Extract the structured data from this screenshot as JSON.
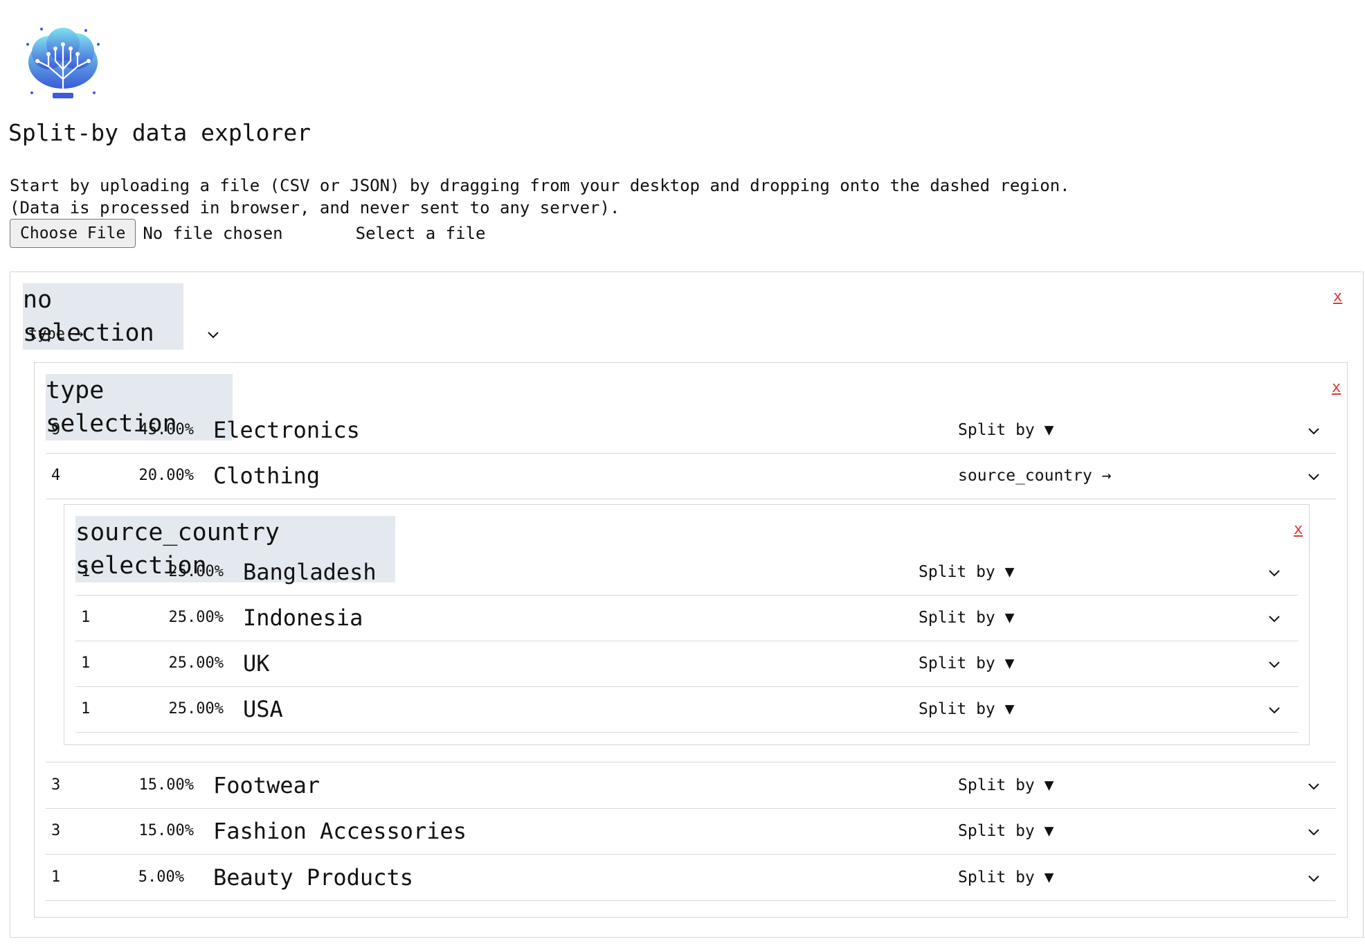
{
  "app": {
    "title": "Split-by data explorer",
    "intro_line1": "Start by uploading a file (CSV or JSON) by dragging from your desktop and dropping onto the dashed region.",
    "intro_line2": "(Data is processed in browser, and never sent to any server).",
    "choose_file_label": "Choose File",
    "no_file_text": "No file chosen",
    "select_file_text": "Select a file"
  },
  "root_panel": {
    "title": "no selection",
    "close_label": "x",
    "selector_label": "type →"
  },
  "type_panel": {
    "title": "type selection",
    "close_label": "x",
    "rows": [
      {
        "count": "9",
        "pct": "45.00%",
        "label": "Electronics",
        "split": "Split by ▼"
      },
      {
        "count": "4",
        "pct": "20.00%",
        "label": "Clothing",
        "split": "source_country →"
      },
      {
        "count": "3",
        "pct": "15.00%",
        "label": "Footwear",
        "split": "Split by ▼"
      },
      {
        "count": "3",
        "pct": "15.00%",
        "label": "Fashion Accessories",
        "split": "Split by ▼"
      },
      {
        "count": "1",
        "pct": "5.00%",
        "label": "Beauty Products",
        "split": "Split by ▼"
      }
    ]
  },
  "country_panel": {
    "title": "source_country selection",
    "close_label": "x",
    "rows": [
      {
        "count": "1",
        "pct": "25.00%",
        "label": "Bangladesh",
        "split": "Split by ▼"
      },
      {
        "count": "1",
        "pct": "25.00%",
        "label": "Indonesia",
        "split": "Split by ▼"
      },
      {
        "count": "1",
        "pct": "25.00%",
        "label": "UK",
        "split": "Split by ▼"
      },
      {
        "count": "1",
        "pct": "25.00%",
        "label": "USA",
        "split": "Split by ▼"
      }
    ]
  },
  "colors": {
    "title_bg": "#e4e9ef",
    "close_red": "#d9383a",
    "border": "#d6d6d6"
  }
}
